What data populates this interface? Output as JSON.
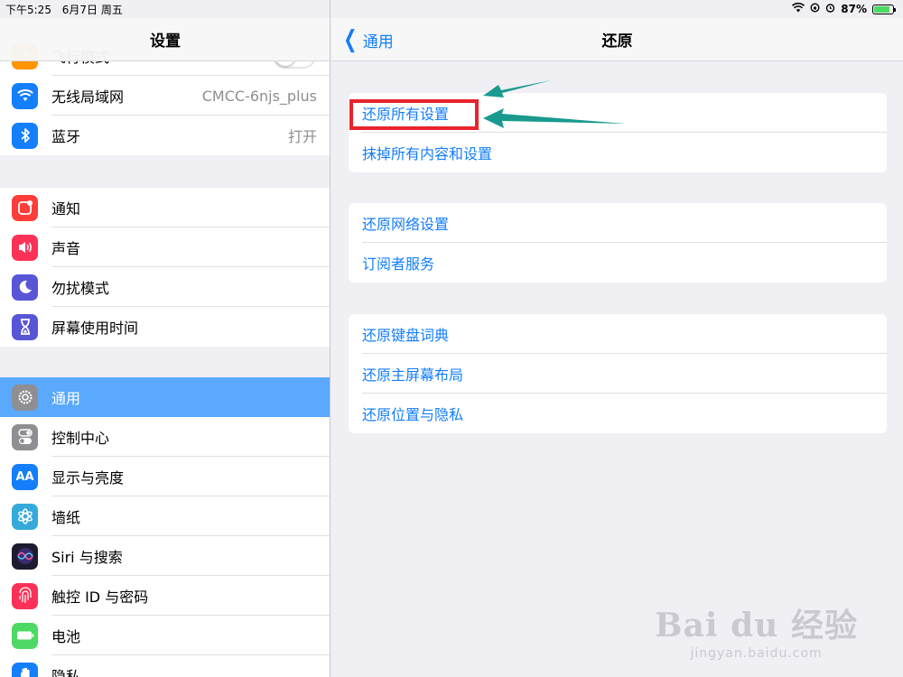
{
  "status": {
    "time": "下午5:25",
    "date": "6月7日 周五",
    "battery": "87%"
  },
  "left": {
    "title": "设置",
    "partial_top_label": "飞行模式",
    "group1": [
      {
        "label": "无线局域网",
        "value": "CMCC-6njs_plus",
        "icon": "wifi-icon",
        "color": "#147efb"
      },
      {
        "label": "蓝牙",
        "value": "打开",
        "icon": "bluetooth-icon",
        "color": "#147efb"
      }
    ],
    "group2": [
      {
        "label": "通知",
        "icon": "notifications-icon",
        "color": "#fc3d39"
      },
      {
        "label": "声音",
        "icon": "sound-icon",
        "color": "#fc3158"
      },
      {
        "label": "勿扰模式",
        "icon": "moon-icon",
        "color": "#5856d6"
      },
      {
        "label": "屏幕使用时间",
        "icon": "hourglass-icon",
        "color": "#5856d6"
      }
    ],
    "group3": [
      {
        "label": "通用",
        "icon": "gear-icon",
        "color": "#8e8e93",
        "selected": true
      },
      {
        "label": "控制中心",
        "icon": "control-center-icon",
        "color": "#8e8e93"
      },
      {
        "label": "显示与亮度",
        "icon": "display-icon",
        "color": "#147efb"
      },
      {
        "label": "墙纸",
        "icon": "wallpaper-icon",
        "color": "#34aadc"
      },
      {
        "label": "Siri 与搜索",
        "icon": "siri-icon",
        "color": "#222"
      },
      {
        "label": "触控 ID 与密码",
        "icon": "fingerprint-icon",
        "color": "#fc3158"
      },
      {
        "label": "电池",
        "icon": "battery-icon",
        "color": "#4cd964"
      },
      {
        "label": "隐私",
        "icon": "privacy-icon",
        "color": "#147efb"
      }
    ]
  },
  "right": {
    "back_label": "通用",
    "title": "还原",
    "group1": [
      "还原所有设置",
      "抹掉所有内容和设置"
    ],
    "group2": [
      "还原网络设置",
      "订阅者服务"
    ],
    "group3": [
      "还原键盘词典",
      "还原主屏幕布局",
      "还原位置与隐私"
    ]
  },
  "annotation_color": "#e8232b",
  "arrow_color": "#1a9a8e",
  "watermark": {
    "logo": "Bai du 经验",
    "url": "jingyan.baidu.com"
  }
}
